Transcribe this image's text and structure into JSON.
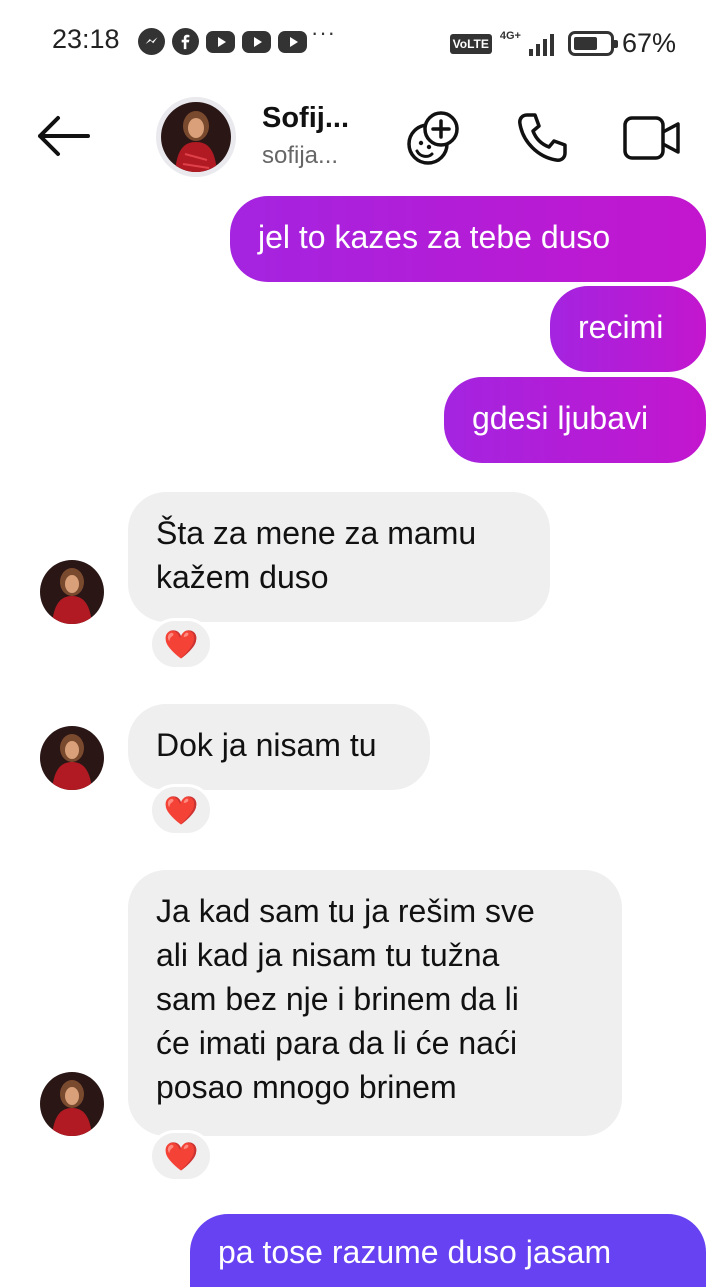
{
  "status_bar": {
    "time": "23:18",
    "dots": "···",
    "volte": "VoLTE",
    "network": "4G+",
    "battery_level": 0.67,
    "battery_percent": "67%",
    "app_icons": [
      "messenger-icon",
      "facebook-icon",
      "youtube-icon",
      "youtube-icon",
      "youtube-icon"
    ]
  },
  "header": {
    "name": "Sofij...",
    "username": "sofija...",
    "icons": [
      "back-arrow-icon",
      "add-emoji-icon",
      "phone-icon",
      "video-camera-icon"
    ]
  },
  "messages": [
    {
      "id": "m1",
      "direction": "out",
      "text": "jel to kazes  za tebe duso"
    },
    {
      "id": "m2",
      "direction": "out",
      "text": "recimi"
    },
    {
      "id": "m3",
      "direction": "out",
      "text": "gdesi ljubavi"
    },
    {
      "id": "m4",
      "direction": "in",
      "lines": [
        "Šta za mene za mamu",
        "kažem duso"
      ],
      "reaction": "❤️"
    },
    {
      "id": "m5",
      "direction": "in",
      "text": "Dok ja nisam tu",
      "reaction": "❤️"
    },
    {
      "id": "m6",
      "direction": "in",
      "lines": [
        "Ja kad sam tu ja rešim sve",
        "ali kad ja nisam tu tužna",
        "sam bez nje i brinem da li",
        "će imati para da li će naći",
        "posao mnogo brinem"
      ],
      "reaction": "❤️"
    },
    {
      "id": "m7",
      "direction": "out",
      "text": "pa tose razume duso jasam"
    }
  ],
  "colors": {
    "outgoing_start": "#a424e0",
    "outgoing_end": "#c316ce",
    "outgoing_latest": "#6742f2",
    "incoming": "#efeff0"
  }
}
